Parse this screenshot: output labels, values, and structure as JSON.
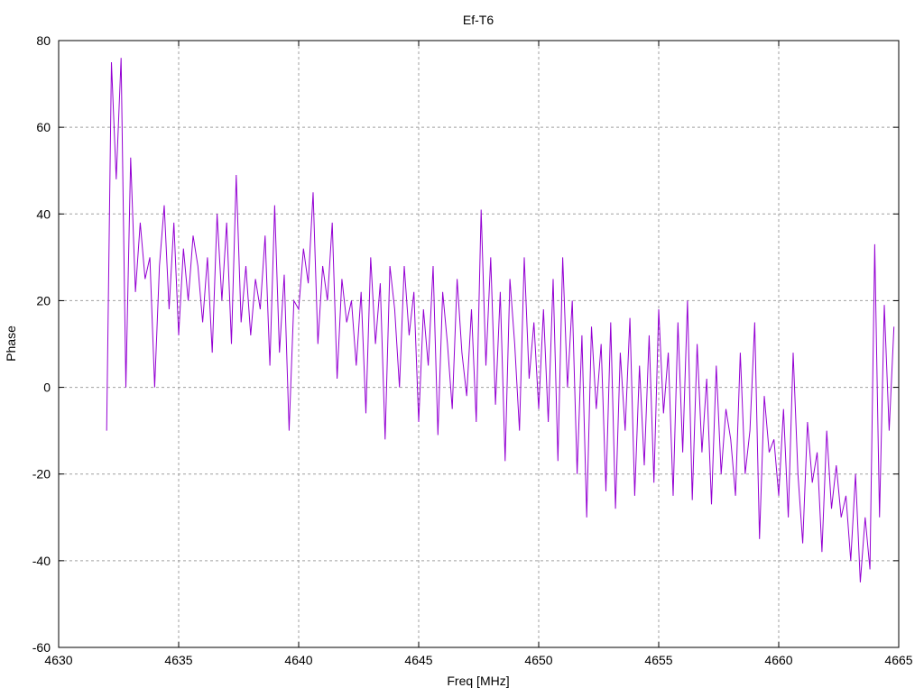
{
  "chart_data": {
    "type": "line",
    "title": "Ef-T6",
    "xlabel": "Freq [MHz]",
    "ylabel": "Phase",
    "xlim": [
      4630,
      4665
    ],
    "ylim": [
      -60,
      80
    ],
    "xticks": [
      4630,
      4635,
      4640,
      4645,
      4650,
      4655,
      4660,
      4665
    ],
    "yticks": [
      -60,
      -40,
      -20,
      0,
      20,
      40,
      60,
      80
    ],
    "xtick_labels": [
      "4630",
      "4635",
      "4640",
      "4645",
      "4650",
      "4655",
      "4660",
      "4665"
    ],
    "ytick_labels": [
      "-60",
      "-40",
      "-20",
      "0",
      "20",
      "40",
      "60",
      "80"
    ],
    "grid": true,
    "series": [
      {
        "name": "Ef-T6",
        "color": "#9400d3",
        "x_start": 4632,
        "x_step": 0.2,
        "values": [
          -10,
          75,
          48,
          76,
          0,
          53,
          22,
          38,
          25,
          30,
          0,
          28,
          42,
          18,
          38,
          12,
          32,
          20,
          35,
          28,
          15,
          30,
          8,
          40,
          20,
          38,
          10,
          49,
          15,
          28,
          12,
          25,
          18,
          35,
          5,
          42,
          8,
          26,
          -10,
          20,
          18,
          32,
          24,
          45,
          10,
          28,
          20,
          38,
          2,
          25,
          15,
          20,
          5,
          22,
          -6,
          30,
          10,
          24,
          -12,
          28,
          18,
          0,
          28,
          12,
          22,
          -8,
          18,
          5,
          28,
          -11,
          22,
          10,
          -5,
          25,
          8,
          -2,
          18,
          -8,
          41,
          5,
          30,
          -4,
          22,
          -17,
          25,
          10,
          -10,
          30,
          2,
          15,
          -5,
          18,
          -8,
          25,
          -17,
          30,
          0,
          20,
          -20,
          12,
          -30,
          14,
          -5,
          10,
          -24,
          15,
          -28,
          8,
          -10,
          16,
          -25,
          5,
          -18,
          12,
          -22,
          18,
          -6,
          8,
          -25,
          15,
          -15,
          20,
          -26,
          10,
          -15,
          2,
          -27,
          5,
          -20,
          -5,
          -12,
          -25,
          8,
          -20,
          -10,
          15,
          -35,
          -2,
          -15,
          -12,
          -25,
          -5,
          -30,
          8,
          -20,
          -36,
          -8,
          -22,
          -15,
          -38,
          -10,
          -28,
          -18,
          -30,
          -25,
          -40,
          -20,
          -45,
          -30,
          -42,
          33,
          -30,
          19,
          -10,
          14
        ]
      }
    ]
  }
}
